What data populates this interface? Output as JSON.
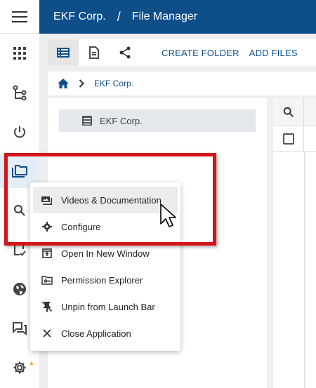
{
  "header": {
    "company": "EKF Corp.",
    "separator": "/",
    "title": "File Manager"
  },
  "rail": {
    "items": [
      {
        "icon": "apps-grid-icon"
      },
      {
        "icon": "tree-branch-icon"
      },
      {
        "icon": "power-icon"
      },
      {
        "icon": "folders-icon",
        "active": true
      },
      {
        "icon": "search-icon"
      },
      {
        "icon": "checklist-icon"
      },
      {
        "icon": "globe-icon"
      },
      {
        "icon": "chat-icon"
      },
      {
        "icon": "gear-icon",
        "badge": "*"
      }
    ]
  },
  "toolbar": {
    "create_folder": "CREATE FOLDER",
    "add_files": "ADD FILES"
  },
  "breadcrumb": {
    "root": "EKF Corp."
  },
  "tree": {
    "node": "EKF Corp."
  },
  "context_menu": {
    "items": [
      {
        "label": "Videos & Documentation",
        "icon": "image-icon"
      },
      {
        "label": "Configure",
        "icon": "gear-icon"
      },
      {
        "label": "Open In New Window",
        "icon": "open-window-icon"
      },
      {
        "label": "Permission Explorer",
        "icon": "folder-key-icon"
      },
      {
        "label": "Unpin from Launch Bar",
        "icon": "unpin-icon"
      },
      {
        "label": "Close Application",
        "icon": "close-icon"
      }
    ]
  },
  "colors": {
    "brand": "#0e4f8a",
    "highlight": "#d4151a",
    "badge": "#f0a020"
  }
}
